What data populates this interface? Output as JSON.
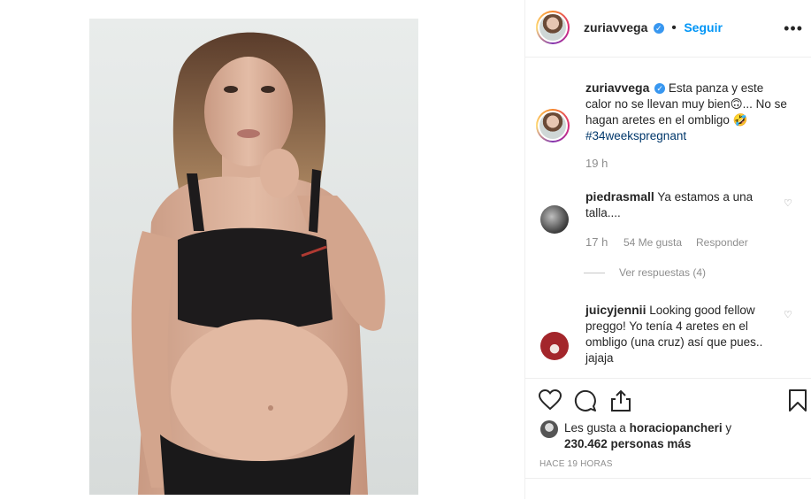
{
  "post": {
    "username": "zuriavvega",
    "follow_label": "Seguir",
    "more_label": "•••",
    "verified_mark": "✓"
  },
  "caption": {
    "username": "zuriavvega",
    "text": "Esta panza y este calor no se llevan muy bien🙃... No se hagan aretes en el ombligo 🤣",
    "hashtag": "#34weekspregnant",
    "time": "19 h"
  },
  "comments": [
    {
      "username": "piedrasmall",
      "text": "Ya estamos a una talla....",
      "time": "17 h",
      "likes": "54 Me gusta",
      "reply_label": "Responder",
      "view_replies": "Ver respuestas (4)"
    },
    {
      "username": "juicyjennii",
      "text": "Looking good fellow preggo! Yo tenía 4 aretes en el ombligo (una cruz) así que pues.. jajaja"
    }
  ],
  "likes": {
    "prefix": "Les gusta a",
    "user": "horaciopancheri",
    "joiner": "y",
    "count": "230.462 personas más"
  },
  "timestamp": "HACE 19 HORAS",
  "icons": {
    "like": "heart-icon",
    "comment": "comment-icon",
    "share": "share-icon",
    "save": "bookmark-icon",
    "more": "more-icon",
    "verified": "verified-icon",
    "comment_like": "heart-icon"
  },
  "colors": {
    "accent": "#0095f6",
    "verified": "#3897f0",
    "muted": "#8e8e8e",
    "hashtag": "#00376b"
  }
}
